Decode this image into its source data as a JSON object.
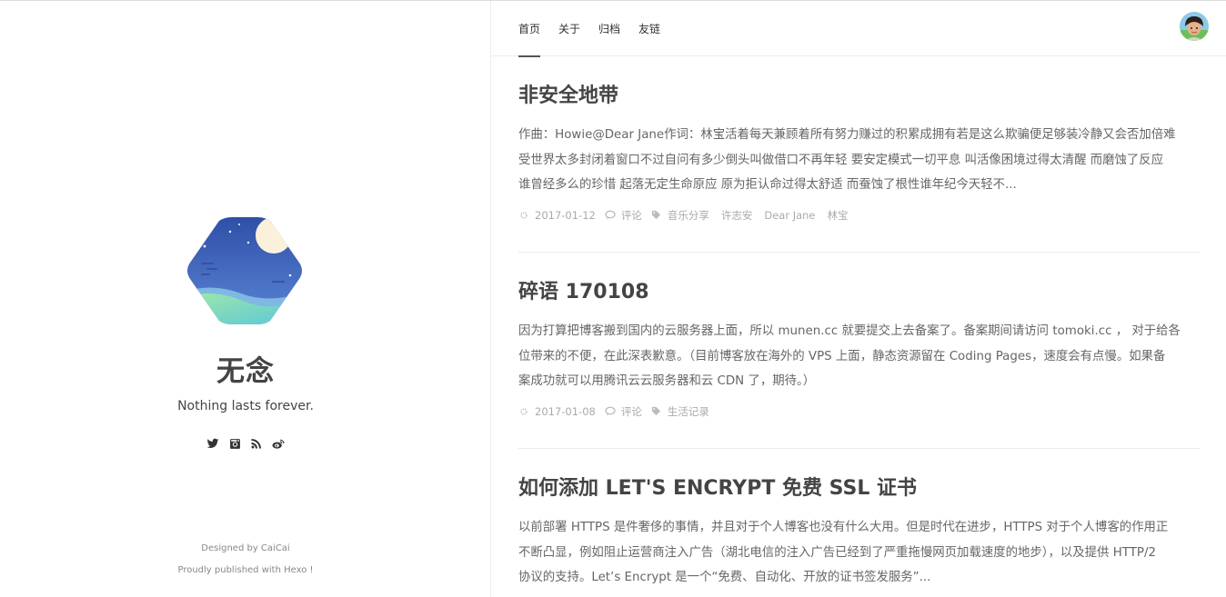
{
  "site": {
    "title": "无念",
    "subtitle": "Nothing lasts forever.",
    "social": [
      "twitter-icon",
      "instagram-icon",
      "rss-icon",
      "weibo-icon"
    ],
    "footer": {
      "designed": "Designed by CaiCai",
      "published": "Proudly published with Hexo !"
    }
  },
  "nav": {
    "items": [
      {
        "label": "首页",
        "active": true
      },
      {
        "label": "关于",
        "active": false
      },
      {
        "label": "归档",
        "active": false
      },
      {
        "label": "友链",
        "active": false
      }
    ]
  },
  "posts": [
    {
      "title": "非安全地带",
      "excerpt": [
        "作曲：Howie@Dear Jane作词：林宝活着每天兼顾着所有努力赚过的积累成拥有若是这么欺骗便足够装冷静又会否加倍难",
        "受世界太多封闭着窗口不过自问有多少倒头叫做借口不再年轻 要安定模式一切平息 叫活像困境过得太清醒 而磨蚀了反应",
        "谁曾经多么的珍惜 起落无定生命原应 原为拒认命过得太舒适 而蚕蚀了根性谁年纪今天轻不..."
      ],
      "date": "2017-01-12",
      "comments": "评论",
      "tags": [
        "音乐分享",
        "许志安",
        "Dear Jane",
        "林宝"
      ]
    },
    {
      "title": "碎语 170108",
      "excerpt": [
        "因为打算把博客搬到国内的云服务器上面，所以 munen.cc 就要提交上去备案了。备案期间请访问 tomoki.cc ， 对于给各",
        "位带来的不便，在此深表歉意。（目前博客放在海外的 VPS 上面，静态资源留在 Coding Pages，速度会有点慢。如果备",
        "案成功就可以用腾讯云云服务器和云 CDN 了，期待。）"
      ],
      "date": "2017-01-08",
      "comments": "评论",
      "tags": [
        "生活记录"
      ]
    },
    {
      "title": "如何添加 LET'S ENCRYPT 免费 SSL 证书",
      "excerpt": [
        "以前部署 HTTPS 是件奢侈的事情，并且对于个人博客也没有什么大用。但是时代在进步，HTTPS 对于个人博客的作用正",
        "不断凸显，例如阻止运营商注入广告（湖北电信的注入广告已经到了严重拖慢网页加载速度的地步），以及提供 HTTP/2",
        "协议的支持。Let’s Encrypt 是一个“免费、自动化、开放的证书签发服务”..."
      ]
    }
  ],
  "colors": {
    "text": "#444444",
    "muted": "#aaaaaa",
    "logo_sky": "#3f63b8",
    "logo_wave": "#7fd6c0",
    "logo_moon": "#fdf3dc"
  }
}
